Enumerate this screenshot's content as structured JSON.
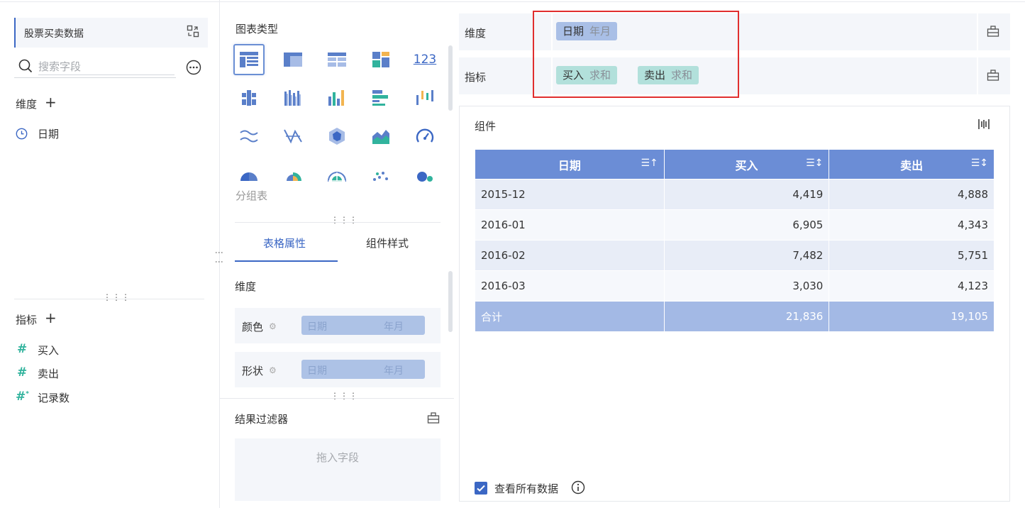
{
  "dataset": {
    "name": "股票买卖数据"
  },
  "search": {
    "placeholder": "搜索字段"
  },
  "left": {
    "dimensions_label": "维度",
    "dimension_fields": [
      "日期"
    ],
    "measures_label": "指标",
    "measure_fields": [
      "买入",
      "卖出",
      "记录数"
    ]
  },
  "chart_types": {
    "title": "图表类型",
    "selected_label": "分组表",
    "icon_names": [
      "grouped-table-icon",
      "cross-table-icon",
      "detail-table-icon",
      "kpi-card-icon",
      "text-123-icon",
      "multi-bar-icon",
      "stacked-column-icon",
      "column-icon",
      "bar-icon",
      "range-column-icon",
      "line-icon",
      "radar-icon",
      "polygon-icon",
      "area-icon",
      "gauge-icon",
      "pie-icon",
      "rose-icon",
      "funnel-icon",
      "scatter-icon",
      "bubble-icon"
    ],
    "kpi_text": "123"
  },
  "tabs": {
    "table_props": "表格属性",
    "component_style": "组件样式"
  },
  "attrs": {
    "section": "维度",
    "color": {
      "label": "颜色",
      "field": "日期",
      "sub": "年月"
    },
    "shape": {
      "label": "形状",
      "field": "日期",
      "sub": "年月"
    }
  },
  "filter": {
    "title": "结果过滤器",
    "drop_text": "拖入字段"
  },
  "shelves": {
    "dimension": {
      "label": "维度",
      "pills": [
        {
          "name": "日期",
          "sub": "年月"
        }
      ]
    },
    "measure": {
      "label": "指标",
      "pills": [
        {
          "name": "买入",
          "sub": "求和"
        },
        {
          "name": "卖出",
          "sub": "求和"
        }
      ]
    }
  },
  "component": {
    "title": "组件",
    "table": {
      "headers": [
        "日期",
        "买入",
        "卖出"
      ],
      "rows": [
        [
          "2015-12",
          "4,419",
          "4,888"
        ],
        [
          "2016-01",
          "6,905",
          "4,343"
        ],
        [
          "2016-02",
          "7,482",
          "5,751"
        ],
        [
          "2016-03",
          "3,030",
          "4,123"
        ]
      ],
      "total": [
        "合计",
        "21,836",
        "19,105"
      ]
    },
    "view_all_label": "查看所有数据",
    "view_all_checked": true
  },
  "colors": {
    "accent": "#3b67c4",
    "header": "#6b8dd6",
    "dim_pill": "#a9bfe6",
    "measure_pill": "#b2e0db",
    "highlight": "#e02e2e"
  }
}
